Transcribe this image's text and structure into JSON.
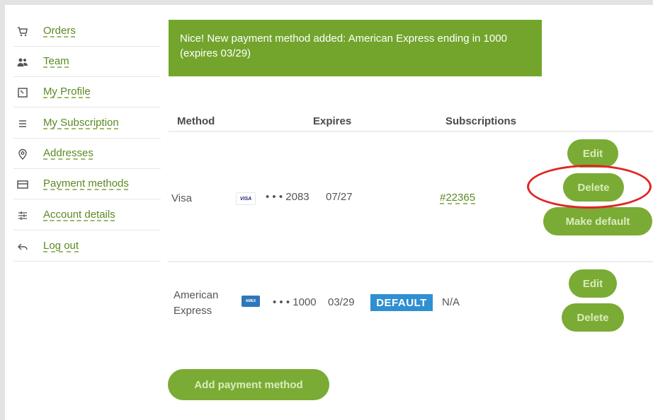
{
  "sidebar": {
    "items": [
      {
        "label": "Orders",
        "icon": "cart-icon"
      },
      {
        "label": "Team",
        "icon": "team-icon"
      },
      {
        "label": "My Profile",
        "icon": "profile-icon"
      },
      {
        "label": "My Subscription",
        "icon": "list-icon"
      },
      {
        "label": "Addresses",
        "icon": "location-pin-icon"
      },
      {
        "label": "Payment methods",
        "icon": "credit-card-icon"
      },
      {
        "label": "Account details",
        "icon": "sliders-icon"
      },
      {
        "label": "Log out",
        "icon": "logout-arrow-icon"
      }
    ]
  },
  "notice": {
    "text": "Nice! New payment method added: American Express ending in 1000 (expires 03/29)"
  },
  "table": {
    "headers": {
      "method": "Method",
      "expires": "Expires",
      "subscriptions": "Subscriptions"
    },
    "rows": [
      {
        "method": "Visa",
        "brand_logo": "VISA",
        "masked": "• • • 2083",
        "expires": "07/27",
        "badge": "",
        "subscription": "#22365",
        "actions": [
          "Edit",
          "Delete",
          "Make default"
        ]
      },
      {
        "method_line1": "American",
        "method_line2": "Express",
        "brand_logo": "AMEX",
        "masked": "• • • 1000",
        "expires": "03/29",
        "badge": "DEFAULT",
        "subscription": "N/A",
        "actions": [
          "Edit",
          "Delete"
        ]
      }
    ]
  },
  "add_button": "Add payment method",
  "colors": {
    "accent_green": "#7aab35",
    "notice_green": "#73a52d",
    "link_green": "#5a8a22",
    "default_badge_blue": "#2f8fd1",
    "highlight_red": "#e02424"
  }
}
